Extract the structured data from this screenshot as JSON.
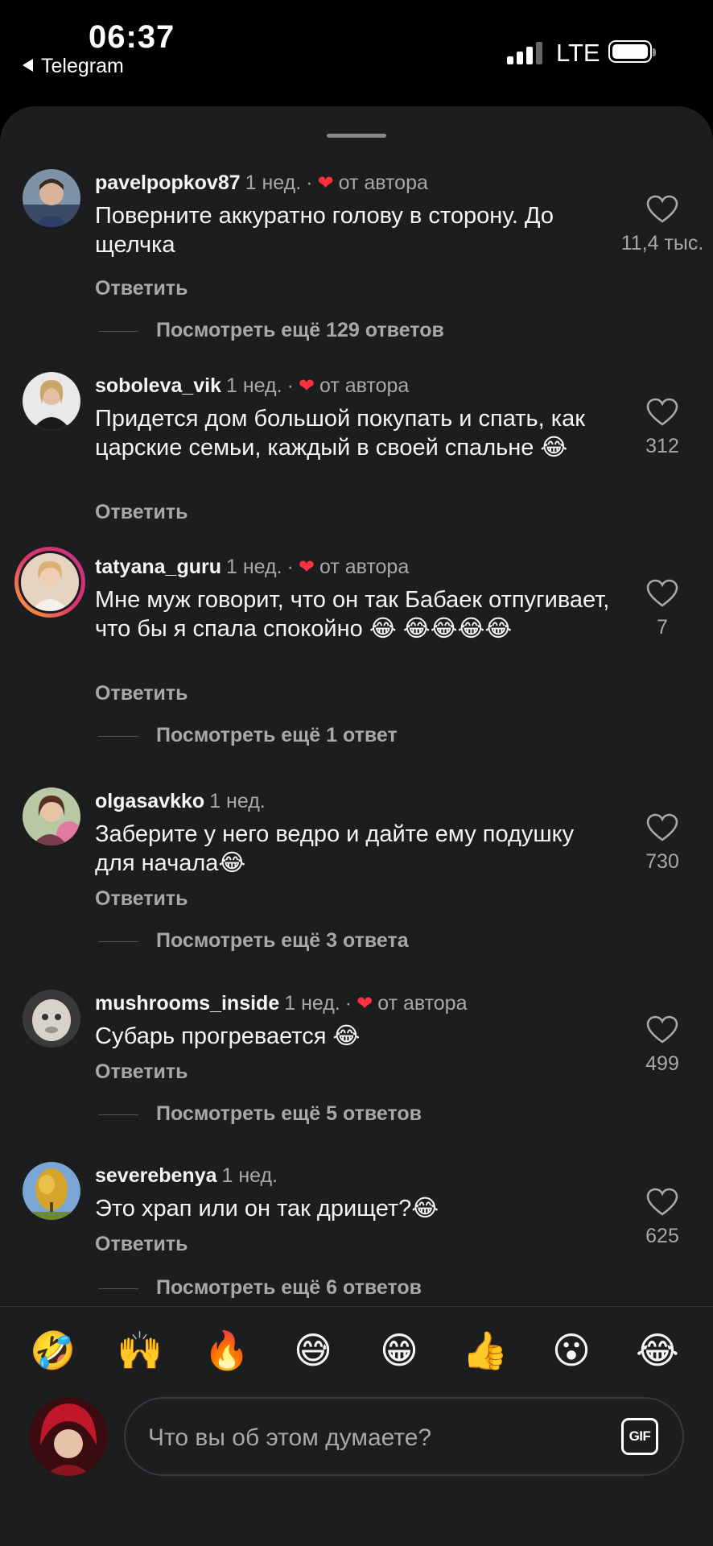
{
  "status_bar": {
    "time": "06:37",
    "back_app": "Telegram",
    "network": "LTE"
  },
  "comments": [
    {
      "username": "pavelpopkov87",
      "time_ago": "1 нед.",
      "liked_by_author": true,
      "liked_label": "от автора",
      "text": "Поверните аккуратно голову в сторону. До щелчка",
      "reply": "Ответить",
      "likes": "11,4 тыс.",
      "more_replies": "Посмотреть ещё 129 ответов"
    },
    {
      "username": "soboleva_vik",
      "time_ago": "1 нед.",
      "liked_by_author": true,
      "liked_label": "от автора",
      "text": "Придется дом большой покупать и спать, как царские семьи, каждый в своей спальне 😂",
      "reply": "Ответить",
      "likes": "312",
      "more_replies": ""
    },
    {
      "username": "tatyana_guru",
      "time_ago": "1 нед.",
      "liked_by_author": true,
      "liked_label": "от автора",
      "text": "Мне муж говорит, что он так Бабаек отпугивает, что бы я спала спокойно 😂 😂😂😂😂",
      "reply": "Ответить",
      "likes": "7",
      "more_replies": "Посмотреть ещё 1 ответ"
    },
    {
      "username": "olgasavkko",
      "time_ago": "1 нед.",
      "liked_by_author": false,
      "liked_label": "",
      "text": "Заберите у него ведро и дайте ему подушку для начала😂",
      "reply": "Ответить",
      "likes": "730",
      "more_replies": "Посмотреть ещё 3 ответа"
    },
    {
      "username": "mushrooms_inside",
      "time_ago": "1 нед.",
      "liked_by_author": true,
      "liked_label": "от автора",
      "text": "Субарь прогревается 😂",
      "reply": "Ответить",
      "likes": "499",
      "more_replies": "Посмотреть ещё 5 ответов"
    },
    {
      "username": "severebenya",
      "time_ago": "1 нед.",
      "liked_by_author": false,
      "liked_label": "",
      "text": "Это храп или он так дрищет?😂",
      "reply": "Ответить",
      "likes": "625",
      "more_replies": "Посмотреть ещё 6 ответов"
    }
  ],
  "quick_emojis": [
    "🤣",
    "🙌",
    "🔥",
    "😅",
    "😁",
    "👍",
    "😮",
    "😂"
  ],
  "composer": {
    "placeholder": "Что вы об этом думаете?",
    "gif_label": "GIF"
  }
}
